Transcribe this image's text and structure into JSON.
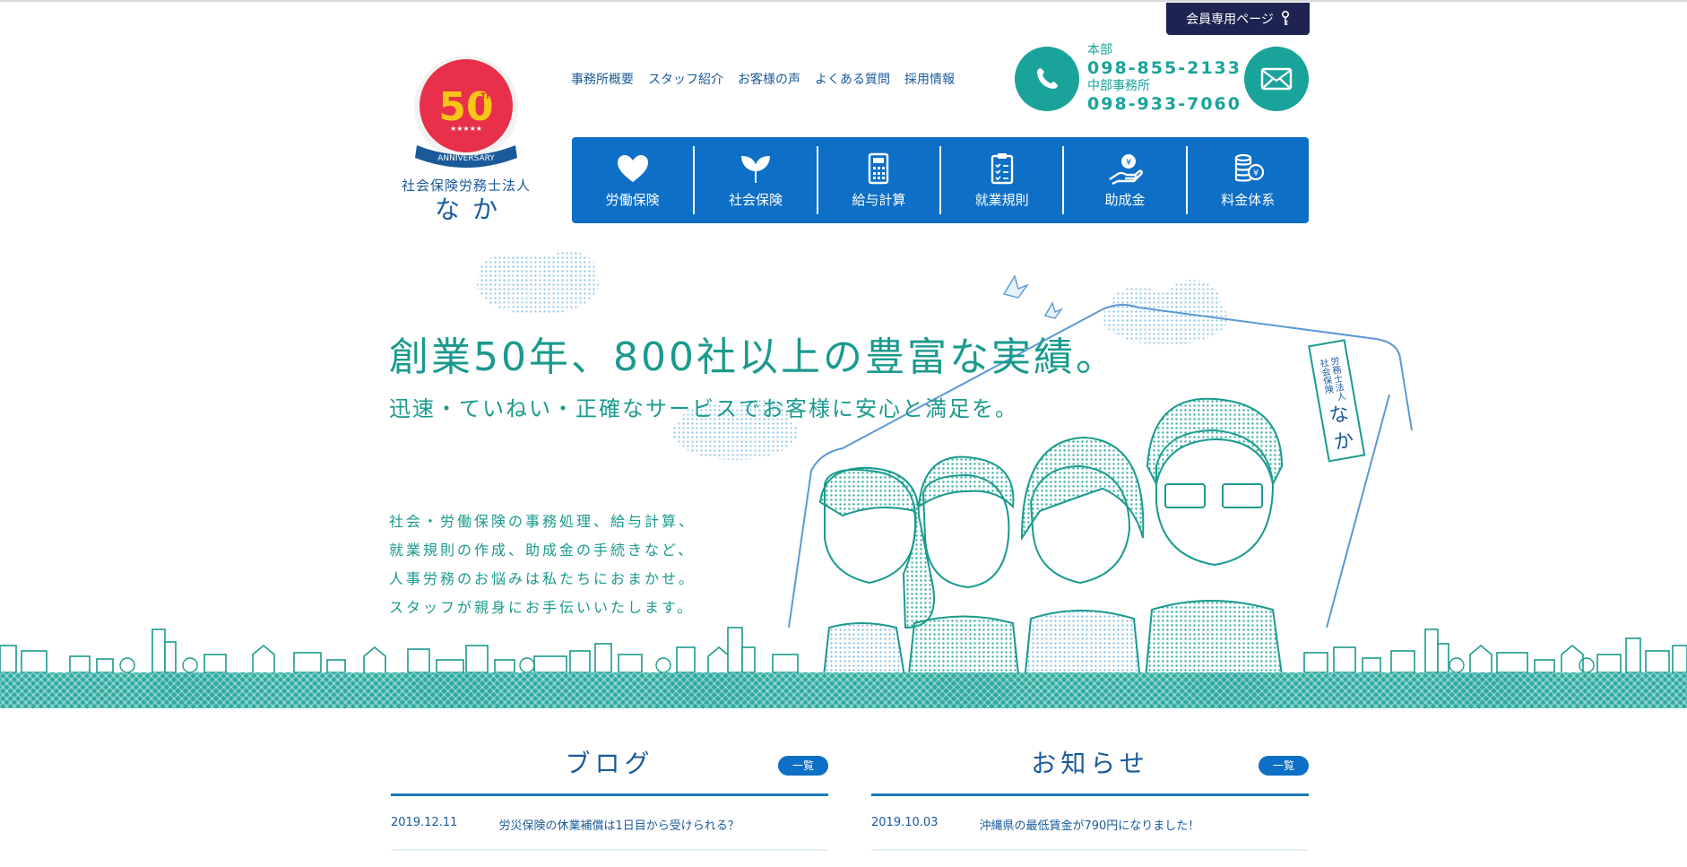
{
  "header": {
    "member_label": "会員専用ページ",
    "logo_corp": "社会保険労務士法人",
    "logo_name": "なか",
    "logo_badge": "50",
    "logo_badge_sup": "TH",
    "logo_ribbon": "ANNIVERSARY"
  },
  "subnav": [
    "事務所概要",
    "スタッフ紹介",
    "お客様の声",
    "よくある質問",
    "採用情報"
  ],
  "contact": {
    "office1_label": "本部",
    "office1_phone": "098-855-2133",
    "office2_label": "中部事務所",
    "office2_phone": "098-933-7060"
  },
  "mainnav": [
    {
      "label": "労働保険",
      "icon": "heart-icon"
    },
    {
      "label": "社会保険",
      "icon": "leaf-icon"
    },
    {
      "label": "給与計算",
      "icon": "calculator-icon"
    },
    {
      "label": "就業規則",
      "icon": "clipboard-icon"
    },
    {
      "label": "助成金",
      "icon": "coin-hand-icon"
    },
    {
      "label": "料金体系",
      "icon": "coins-icon"
    }
  ],
  "hero": {
    "headline": "創業50年、800社以上の豊富な実績。",
    "subline": "迅速・ていねい・正確なサービスでお客様に安心と満足を。",
    "desc": [
      "社会・労働保険の事務処理、給与計算、",
      "就業規則の作成、助成金の手続きなど、",
      "人事労務のお悩みは私たちにおまかせ。",
      "スタッフが親身にお手伝いいたします。"
    ],
    "sign_small": "社会保険 労務士法人",
    "sign_big": "なか"
  },
  "blog": {
    "title": "ブログ",
    "all_label": "一覧",
    "items": [
      {
        "date": "2019.12.11",
        "title": "労災保険の休業補償は1日目から受けられる？"
      }
    ]
  },
  "news": {
    "title": "お知らせ",
    "all_label": "一覧",
    "items": [
      {
        "date": "2019.10.03",
        "title": "沖縄県の最低賃金が790円になりました！"
      }
    ]
  },
  "colors": {
    "navy": "#1d2452",
    "blue": "#0d6fc6",
    "teal": "#1aa39a",
    "red": "#e8304a",
    "gold": "#f5c518"
  }
}
